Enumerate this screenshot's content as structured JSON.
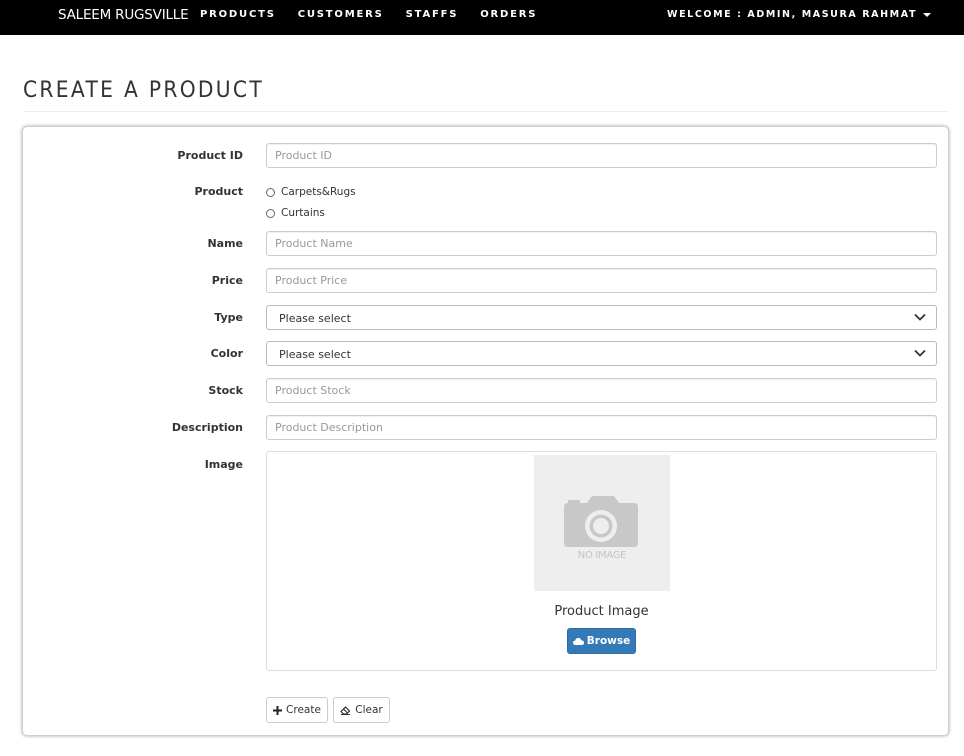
{
  "navbar": {
    "brand": "SALEEM RUGSVILLE",
    "links": [
      "PRODUCTS",
      "CUSTOMERS",
      "STAFFS",
      "ORDERS"
    ],
    "welcome": "WELCOME : ADMIN, MASURA RAHMAT"
  },
  "page": {
    "title": "CREATE A PRODUCT"
  },
  "form": {
    "product_id": {
      "label": "Product ID",
      "placeholder": "Product ID"
    },
    "product": {
      "label": "Product",
      "options": [
        "Carpets&Rugs",
        "Curtains"
      ]
    },
    "name": {
      "label": "Name",
      "placeholder": "Product Name"
    },
    "price": {
      "label": "Price",
      "placeholder": "Product Price"
    },
    "type": {
      "label": "Type",
      "value": "Please select"
    },
    "color": {
      "label": "Color",
      "value": "Please select"
    },
    "stock": {
      "label": "Stock",
      "placeholder": "Product Stock"
    },
    "description": {
      "label": "Description",
      "placeholder": "Product Description"
    },
    "image": {
      "label": "Image",
      "placeholder_text": "NO IMAGE",
      "caption": "Product Image",
      "browse_label": "Browse"
    }
  },
  "actions": {
    "create_label": "Create",
    "clear_label": "Clear"
  },
  "colors": {
    "navbar_bg": "#000000",
    "primary": "#337ab7",
    "border": "#cccccc"
  },
  "icons": {
    "browse": "cloud-icon",
    "create": "plus-icon",
    "clear": "eraser-icon",
    "dropdown": "chevron-down-icon",
    "user_menu": "caret-down-icon"
  }
}
